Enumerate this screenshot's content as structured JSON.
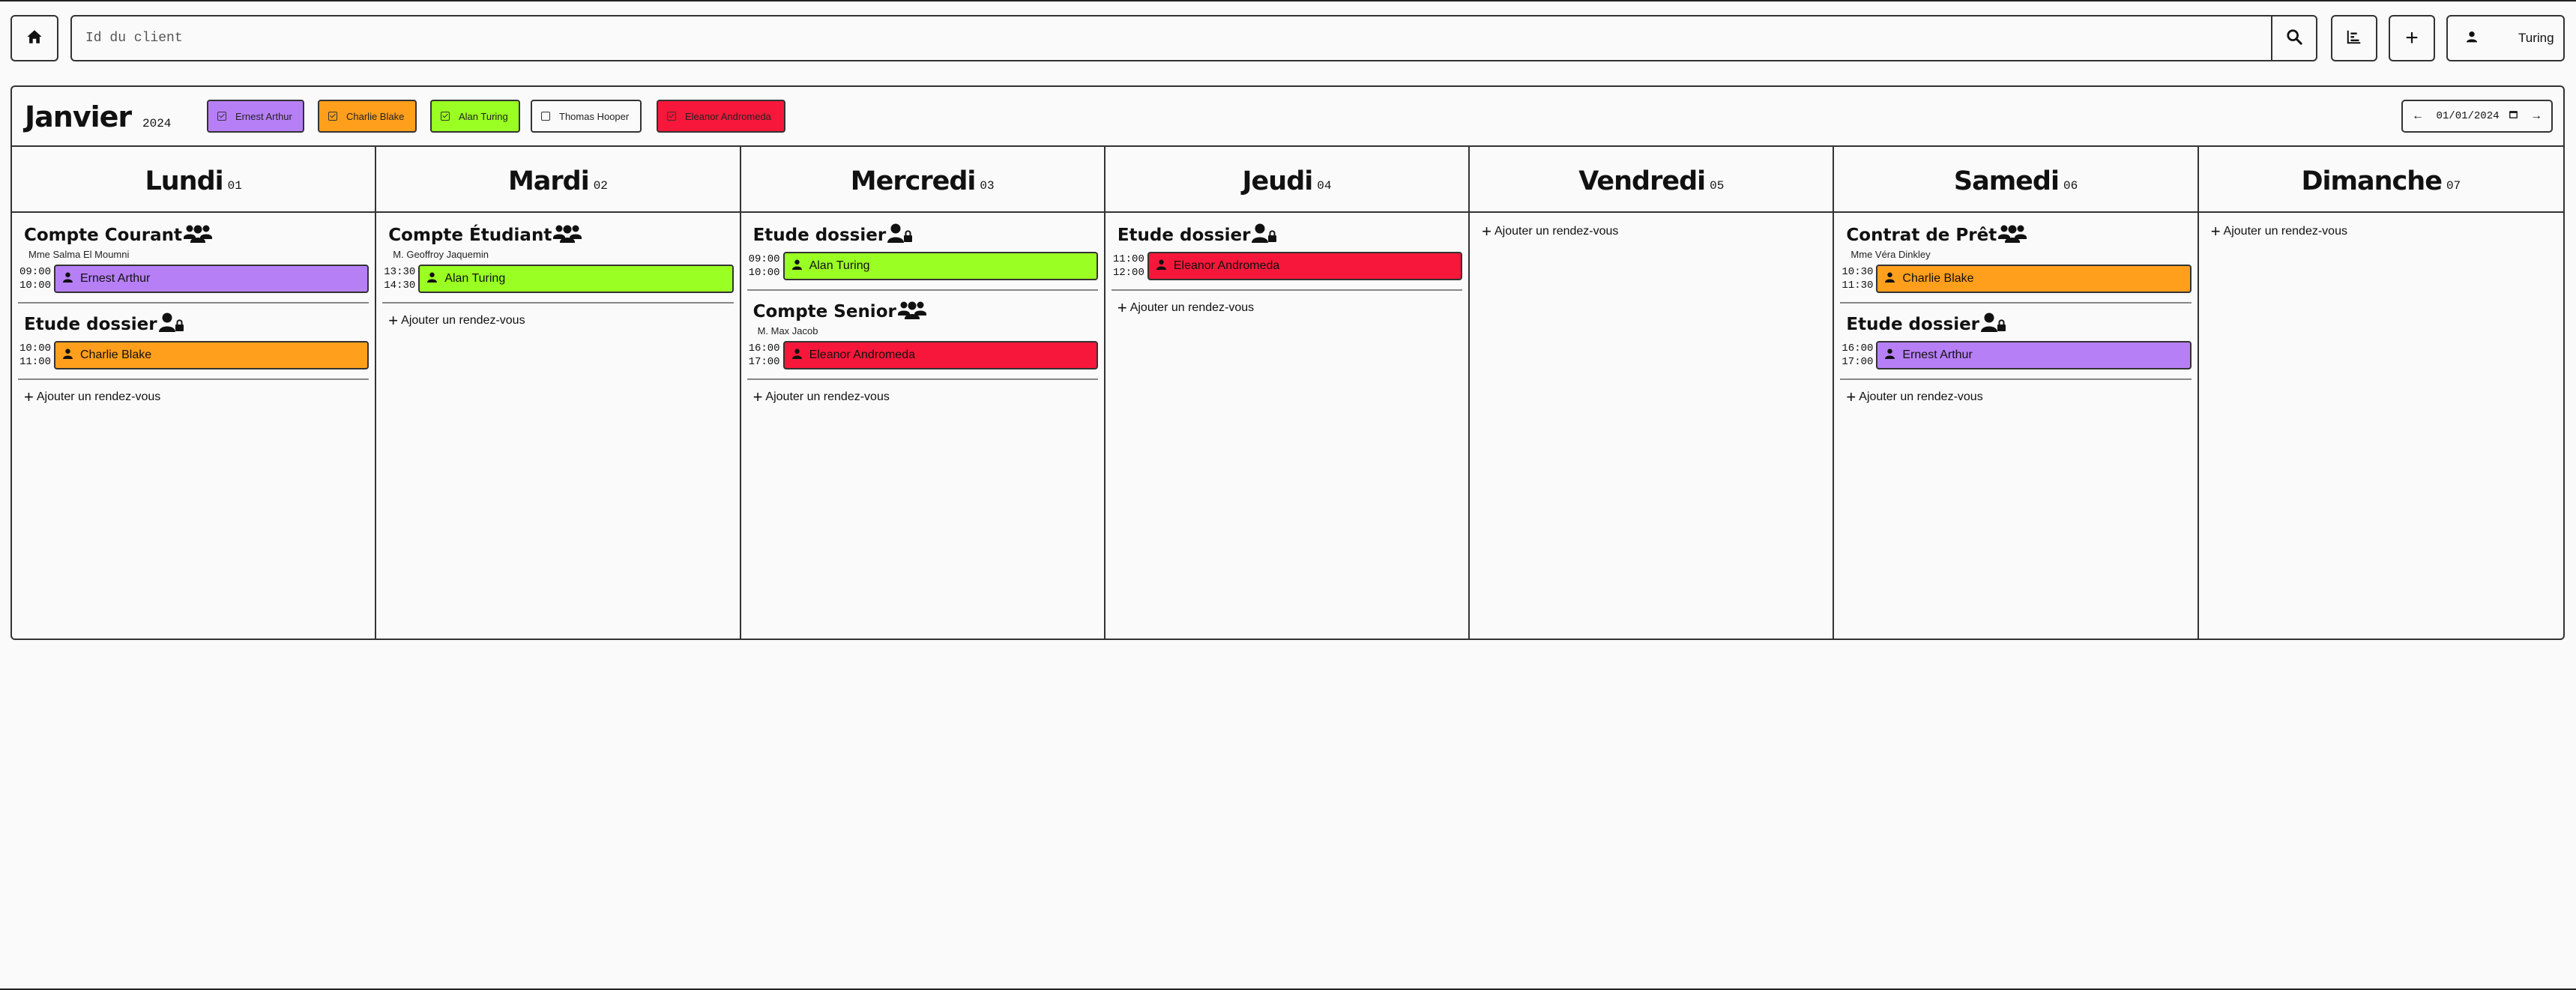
{
  "search": {
    "placeholder": "Id du client"
  },
  "user": {
    "name": "Turing"
  },
  "calendar": {
    "month": "Janvier",
    "year": "2024",
    "date_value": "01/01/2024"
  },
  "advisors": [
    {
      "name": "Ernest Arthur",
      "color": "#b77ff6",
      "checked": true
    },
    {
      "name": "Charlie Blake",
      "color": "#ff9f1c",
      "checked": true
    },
    {
      "name": "Alan Turing",
      "color": "#9aff22",
      "checked": true
    },
    {
      "name": "Thomas Hooper",
      "color": "#fafafa",
      "checked": false
    },
    {
      "name": "Eleanor Andromeda",
      "color": "#f7173a",
      "checked": true
    }
  ],
  "add_label": "Ajouter un rendez-vous",
  "days": [
    {
      "name": "Lundi",
      "num": "01",
      "appointments": [
        {
          "title": "Compte Courant",
          "icon": "group-icon",
          "client": "Mme Salma El Moumni",
          "start": "09:00",
          "end": "10:00",
          "advisor": "Ernest Arthur",
          "color": "#b77ff6"
        },
        {
          "title": "Etude dossier",
          "icon": "user-lock-icon",
          "client": "",
          "start": "10:00",
          "end": "11:00",
          "advisor": "Charlie Blake",
          "color": "#ff9f1c"
        }
      ]
    },
    {
      "name": "Mardi",
      "num": "02",
      "appointments": [
        {
          "title": "Compte Étudiant",
          "icon": "group-icon",
          "client": "M. Geoffroy Jaquemin",
          "start": "13:30",
          "end": "14:30",
          "advisor": "Alan Turing",
          "color": "#9aff22"
        }
      ]
    },
    {
      "name": "Mercredi",
      "num": "03",
      "appointments": [
        {
          "title": "Etude dossier",
          "icon": "user-lock-icon",
          "client": "",
          "start": "09:00",
          "end": "10:00",
          "advisor": "Alan Turing",
          "color": "#9aff22"
        },
        {
          "title": "Compte Senior",
          "icon": "group-icon",
          "client": "M. Max Jacob",
          "start": "16:00",
          "end": "17:00",
          "advisor": "Eleanor Andromeda",
          "color": "#f7173a"
        }
      ]
    },
    {
      "name": "Jeudi",
      "num": "04",
      "appointments": [
        {
          "title": "Etude dossier",
          "icon": "user-lock-icon",
          "client": "",
          "start": "11:00",
          "end": "12:00",
          "advisor": "Eleanor Andromeda",
          "color": "#f7173a"
        }
      ]
    },
    {
      "name": "Vendredi",
      "num": "05",
      "appointments": []
    },
    {
      "name": "Samedi",
      "num": "06",
      "appointments": [
        {
          "title": "Contrat de Prêt",
          "icon": "group-icon",
          "client": "Mme Véra Dinkley",
          "start": "10:30",
          "end": "11:30",
          "advisor": "Charlie Blake",
          "color": "#ff9f1c"
        },
        {
          "title": "Etude dossier",
          "icon": "user-lock-icon",
          "client": "",
          "start": "16:00",
          "end": "17:00",
          "advisor": "Ernest Arthur",
          "color": "#b77ff6"
        }
      ]
    },
    {
      "name": "Dimanche",
      "num": "07",
      "appointments": []
    }
  ]
}
